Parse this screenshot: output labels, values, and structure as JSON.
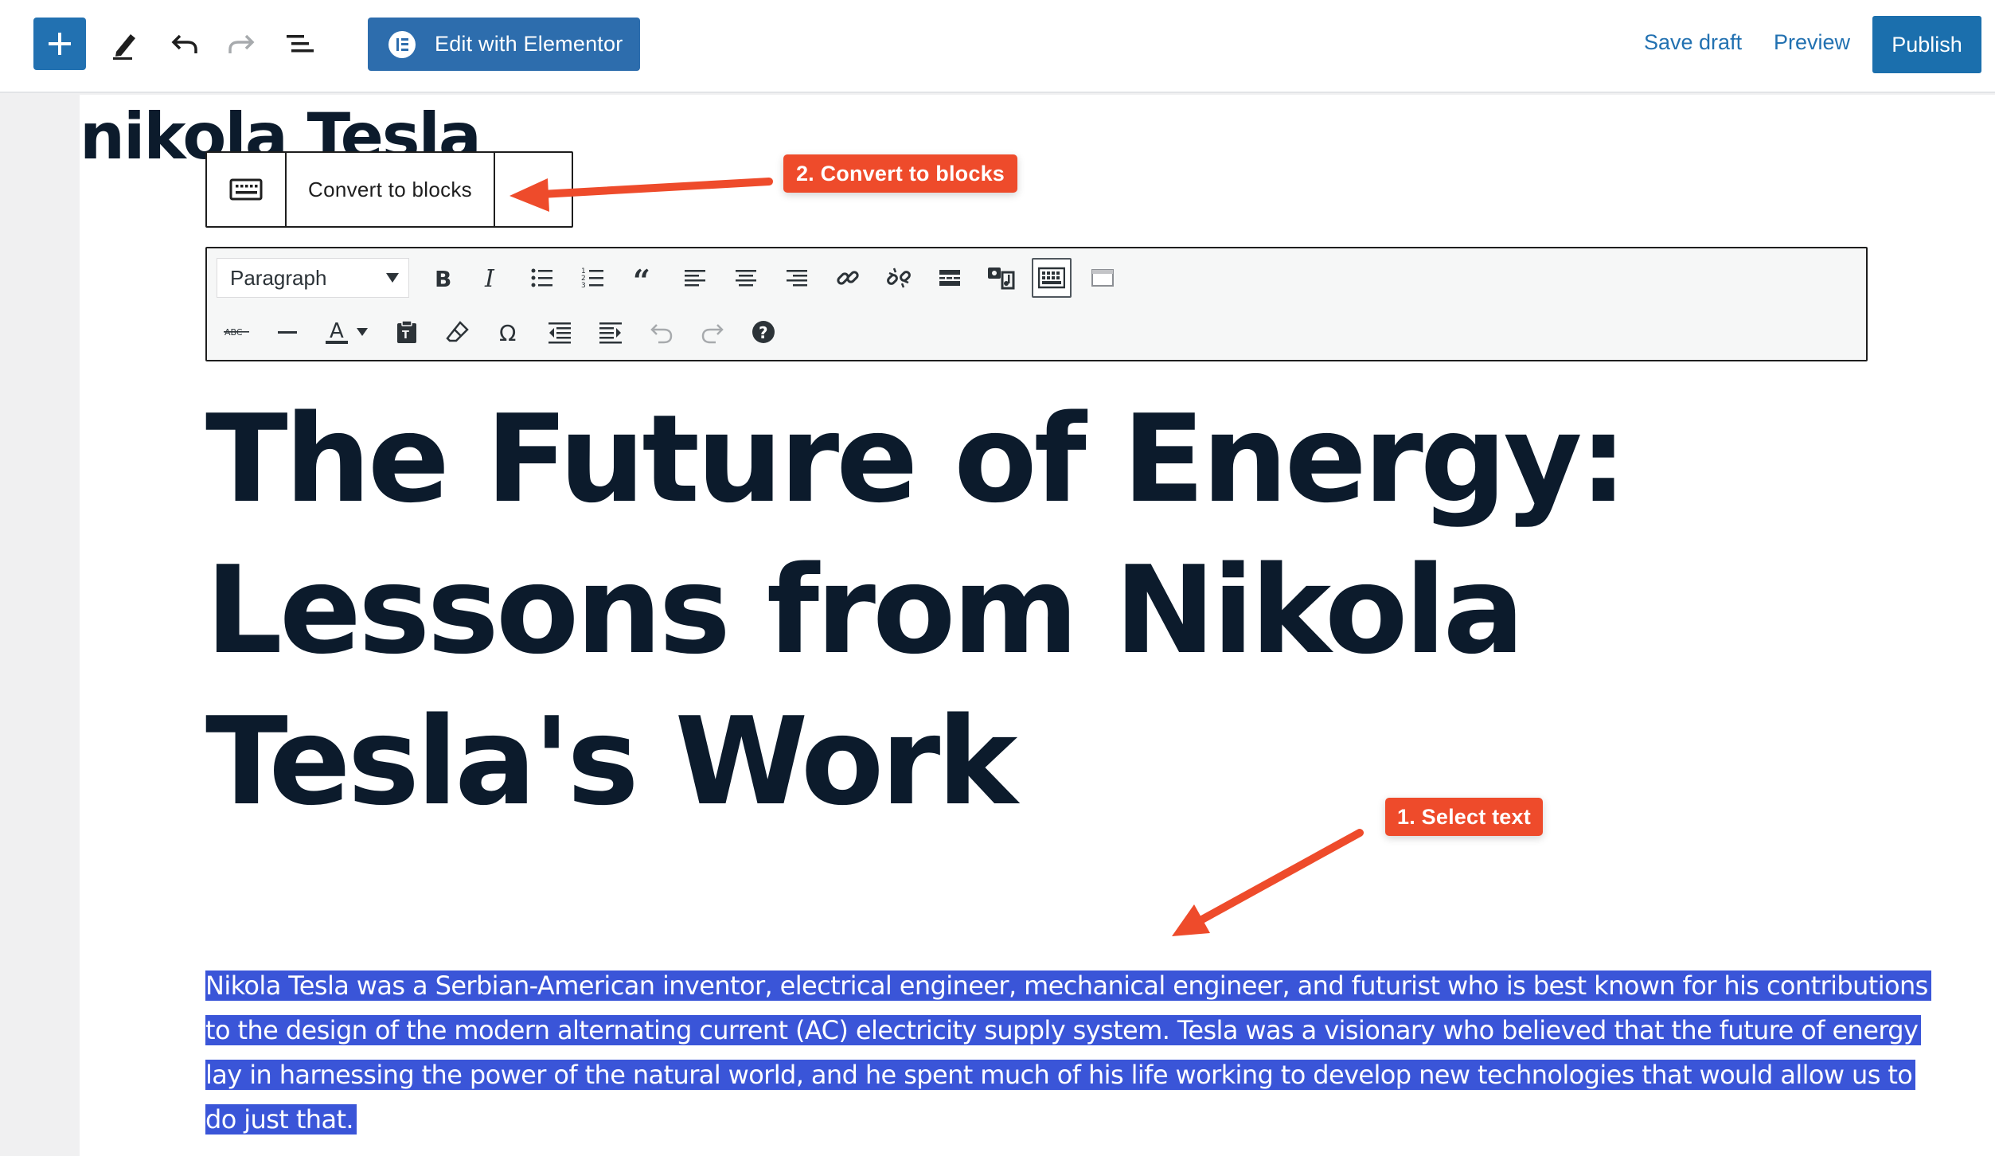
{
  "topbar": {
    "add_label": "+",
    "elementor_label": "Edit with Elementor",
    "save_draft_label": "Save draft",
    "preview_label": "Preview",
    "publish_label": "Publish",
    "icons": [
      "plus-icon",
      "pencil-icon",
      "undo-icon",
      "redo-icon",
      "list-view-icon",
      "elementor-icon"
    ]
  },
  "post": {
    "title": "nikola Tesla"
  },
  "block_toolbar": {
    "convert_label": "Convert to blocks",
    "icon": "keyboard-icon"
  },
  "classic_toolbar": {
    "format_value": "Paragraph",
    "row1_icons": [
      "bold-icon",
      "italic-icon",
      "bullet-list-icon",
      "numbered-list-icon",
      "blockquote-icon",
      "align-left-icon",
      "align-center-icon",
      "align-right-icon",
      "link-icon",
      "unlink-icon",
      "read-more-icon",
      "media-icon",
      "toolbar-toggle-icon",
      "fullscreen-icon"
    ],
    "row2_icons": [
      "strikethrough-icon",
      "horizontal-line-icon",
      "text-color-icon",
      "text-color-dropdown-icon",
      "paste-text-icon",
      "clear-formatting-icon",
      "special-character-icon",
      "outdent-icon",
      "indent-icon",
      "undo-icon",
      "redo-icon",
      "help-icon"
    ],
    "strikethrough_label": "ABC",
    "text_color_label": "A",
    "special_char_label": "Ω",
    "help_label": "?"
  },
  "content": {
    "headline_lines": [
      "The Future of Energy:",
      "Lessons from Nikola",
      "Tesla's Work"
    ],
    "paragraph_lines": [
      "Nikola Tesla was a Serbian-American inventor, electrical engineer, mechanical engineer, and futurist who is best known for his contributions",
      "to the design of the modern alternating current (AC) electricity supply system. Tesla was a visionary who believed that the future of energy",
      "lay in harnessing the power of the natural world, and he spent much of his life working to develop new technologies that would allow us to",
      "do just that."
    ]
  },
  "annotations": {
    "step1_label": "1. Select text",
    "step2_label": "2. Convert to blocks",
    "color": "#ee4b2b"
  },
  "colors": {
    "accent": "#2271b1",
    "selection": "#3a55d8",
    "heading": "#0c1b2c"
  }
}
